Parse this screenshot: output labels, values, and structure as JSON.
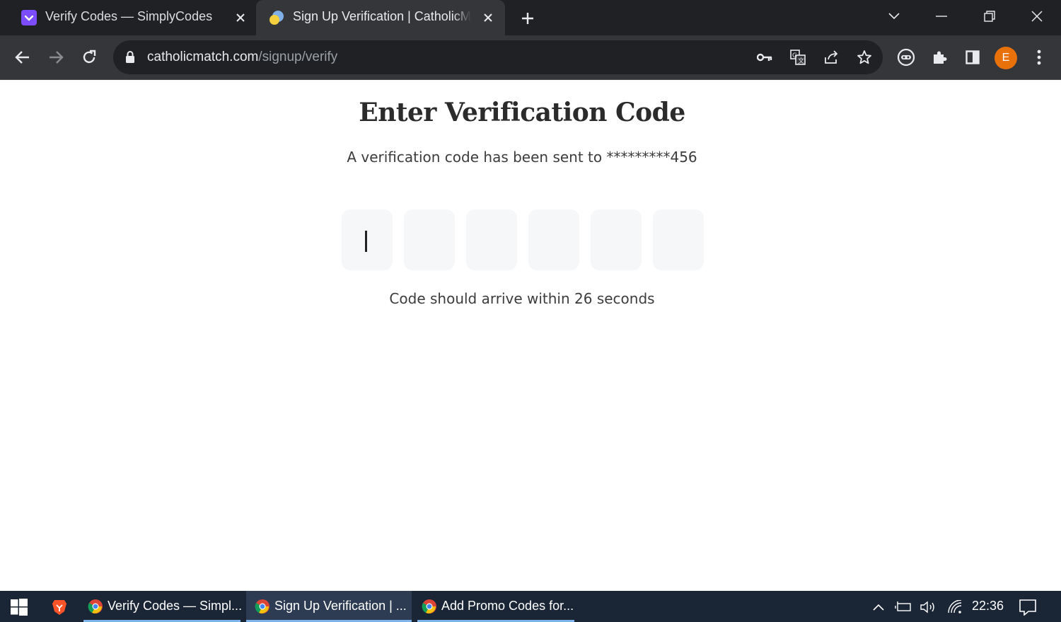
{
  "browser": {
    "tabs": [
      {
        "title": "Verify Codes — SimplyCodes",
        "favicon": "simplycodes-icon",
        "active": false
      },
      {
        "title": "Sign Up Verification | CatholicMatch",
        "favicon": "catholicmatch-icon",
        "active": true
      }
    ],
    "url": {
      "domain": "catholicmatch.com",
      "path": "/signup/verify"
    },
    "profile_initial": "E",
    "accent_color": "#e8710a"
  },
  "page": {
    "heading": "Enter Verification Code",
    "subtext": "A verification code has been sent to *********456",
    "code_digits": [
      "",
      "",
      "",
      "",
      "",
      ""
    ],
    "countdown": "Code should arrive within 26 seconds"
  },
  "taskbar": {
    "tasks": [
      {
        "label": "Verify Codes — Simpl...",
        "icon": "chrome-icon",
        "active": false
      },
      {
        "label": "Sign Up Verification | ...",
        "icon": "chrome-icon",
        "active": true
      },
      {
        "label": "Add Promo Codes for...",
        "icon": "chrome-icon",
        "active": false
      }
    ],
    "clock": "22:36"
  }
}
